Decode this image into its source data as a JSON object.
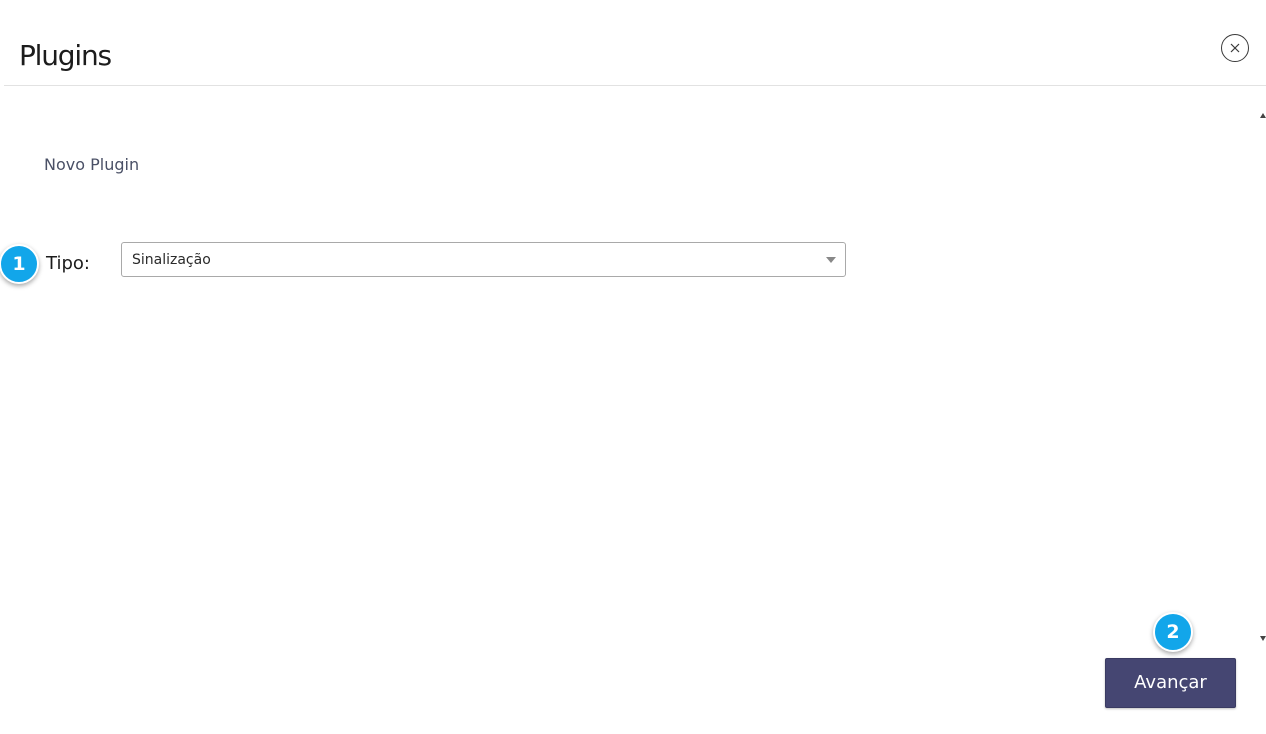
{
  "header": {
    "title": "Plugins",
    "close_icon": "close-icon"
  },
  "section": {
    "title": "Novo Plugin"
  },
  "form": {
    "type_label": "Tipo:",
    "type_value": "Sinalização"
  },
  "steps": {
    "step1": "1",
    "step2": "2",
    "color": "#12a6ea"
  },
  "footer": {
    "next_label": "Avançar",
    "button_color": "#454672"
  }
}
